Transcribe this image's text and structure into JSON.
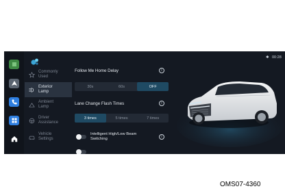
{
  "status": {
    "icon": "bluetooth-icon",
    "time": "00:28"
  },
  "dock": {
    "items": [
      {
        "name": "home-screen-icon",
        "color": "#3f8a44"
      },
      {
        "name": "navigation-icon",
        "color": "#5b6470"
      },
      {
        "name": "phone-icon",
        "color": "#2f7fe0"
      },
      {
        "name": "apps-grid-icon",
        "color": "#2f7fe0"
      },
      {
        "name": "home-icon",
        "color": "#10141b"
      }
    ]
  },
  "sidebar": {
    "items": [
      {
        "label_line1": "Commonly",
        "label_line2": "Used",
        "icon": "star-icon",
        "active": false
      },
      {
        "label_line1": "Exterior",
        "label_line2": "Lamp",
        "icon": "headlamp-icon",
        "active": true
      },
      {
        "label_line1": "Ambient",
        "label_line2": "Lamp",
        "icon": "ambient-light-icon",
        "active": false
      },
      {
        "label_line1": "Driver",
        "label_line2": "Assistance",
        "icon": "steering-wheel-icon",
        "active": false
      },
      {
        "label_line1": "Vehicle",
        "label_line2": "Settings",
        "icon": "car-icon",
        "active": false
      }
    ]
  },
  "settings": {
    "follow_me_home": {
      "title": "Follow Me Home Delay",
      "options": [
        "30s",
        "60s",
        "OFF"
      ],
      "selected": "OFF"
    },
    "lane_change": {
      "title": "Lane Change Flash Times",
      "options": [
        "3 times",
        "5 times",
        "7 times"
      ],
      "selected": "3 times"
    },
    "high_low_beam": {
      "label_line1": "Intelligent High/Low Beam",
      "label_line2": "Switching",
      "enabled": false
    },
    "next_item_partial": {
      "enabled": false
    }
  },
  "colors": {
    "screen_bg": "#141922",
    "accent": "#1f4a63",
    "text": "#e6eaef",
    "muted": "#7c8491"
  },
  "figure_code": "OMS07-4360"
}
